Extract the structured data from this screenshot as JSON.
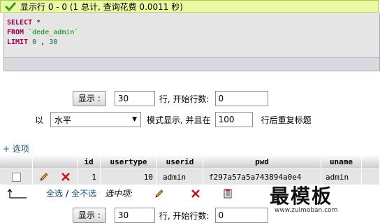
{
  "message": {
    "text": "显示行 0 - 0 (1 总计, 查询花费 0.0011 秒)"
  },
  "sql": {
    "select_kw": "SELECT",
    "select_star": "*",
    "from_kw": "FROM",
    "from_table": "`dede_admin`",
    "limit_kw": "LIMIT",
    "limit_offset": "0",
    "limit_comma": ",",
    "limit_count": "30"
  },
  "nav_top": {
    "show_button": "显示 :",
    "rows_value": "30",
    "rows_label": "行, 开始行数:",
    "start_value": "0",
    "mode_prefix": "以",
    "mode_value": "水平",
    "mode_label": "模式显示, 并且在",
    "repeat_value": "100",
    "repeat_label": "行后重复标题"
  },
  "options_link": "+ 选项",
  "table": {
    "columns": [
      "id",
      "usertype",
      "userid",
      "pwd",
      "uname"
    ],
    "rows": [
      {
        "id": "1",
        "usertype": "10",
        "userid": "admin",
        "pwd": "f297a57a5a743894a0e4",
        "uname": "admin"
      }
    ]
  },
  "bulk": {
    "select_all": "全选",
    "separator": "/",
    "deselect_all": "全不选",
    "with_selected": "选中项:"
  },
  "nav_bottom": {
    "show_button": "显示 :",
    "rows_value": "30",
    "rows_label": "行, 开始行数:",
    "start_value": "0"
  },
  "watermark": {
    "text": "最模板",
    "url": "www.zuimoban.com"
  },
  "colors": {
    "success_bg": "#ebf8a4",
    "link": "#235a81",
    "keyword": "#990055"
  }
}
